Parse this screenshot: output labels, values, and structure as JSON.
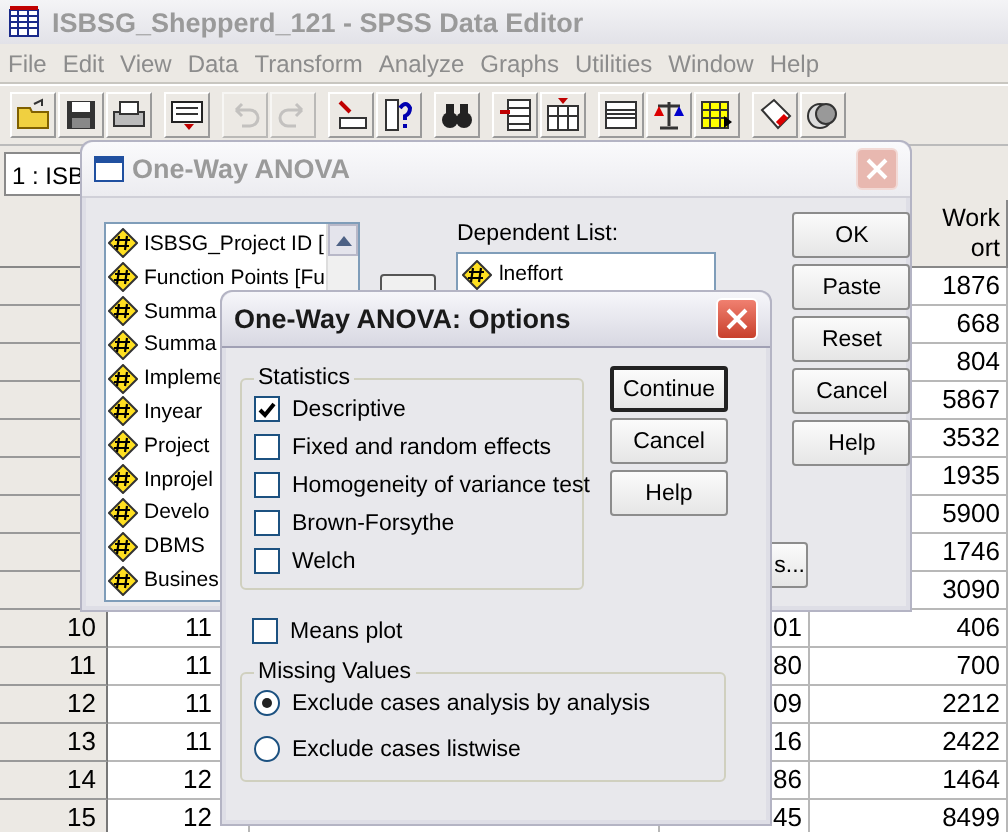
{
  "window": {
    "title": "ISBSG_Shepperd_121 - SPSS Data Editor"
  },
  "menu": [
    "File",
    "Edit",
    "View",
    "Data",
    "Transform",
    "Analyze",
    "Graphs",
    "Utilities",
    "Window",
    "Help"
  ],
  "toolbar": [
    {
      "items": [
        {
          "kind": "open",
          "disabled": false
        },
        {
          "kind": "save",
          "disabled": false
        },
        {
          "kind": "print",
          "disabled": false
        }
      ]
    },
    {
      "items": [
        {
          "kind": "recall",
          "disabled": false
        }
      ]
    },
    {
      "items": [
        {
          "kind": "undo",
          "disabled": true
        },
        {
          "kind": "redo",
          "disabled": true
        }
      ]
    },
    {
      "items": [
        {
          "kind": "goto",
          "disabled": false
        },
        {
          "kind": "variables",
          "disabled": false
        }
      ]
    },
    {
      "items": [
        {
          "kind": "find",
          "disabled": false
        }
      ]
    },
    {
      "items": [
        {
          "kind": "insert_case",
          "disabled": false
        },
        {
          "kind": "insert_variable",
          "disabled": false
        }
      ]
    },
    {
      "items": [
        {
          "kind": "split",
          "disabled": false
        },
        {
          "kind": "weight",
          "disabled": false
        },
        {
          "kind": "select",
          "disabled": false
        }
      ]
    },
    {
      "items": [
        {
          "kind": "labels",
          "disabled": false
        },
        {
          "kind": "sets",
          "disabled": false
        }
      ]
    }
  ],
  "cell_reference": "1 : ISB",
  "table": {
    "column_5_header": [
      "Work",
      "ort"
    ],
    "rows": [
      {
        "column_5": "1876"
      },
      {
        "column_5": "668"
      },
      {
        "column_5": "804"
      },
      {
        "column_5": "5867"
      },
      {
        "column_5": "3532"
      },
      {
        "column_5": "1935"
      },
      {
        "column_5": "5900"
      },
      {
        "column_5": "1746"
      },
      {
        "column_5": "3090"
      },
      {
        "row_number": "10",
        "column_2": "11",
        "column_4": "01",
        "column_5": "406"
      },
      {
        "row_number": "11",
        "column_2": "11",
        "column_4": "80",
        "column_5": "700"
      },
      {
        "row_number": "12",
        "column_2": "11",
        "column_4": "09",
        "column_5": "2212"
      },
      {
        "row_number": "13",
        "column_2": "11",
        "column_4": "16",
        "column_5": "2422"
      },
      {
        "row_number": "14",
        "column_2": "12",
        "column_4": "86",
        "column_5": "1464"
      },
      {
        "row_number": "15",
        "column_2": "12",
        "column_4": "45",
        "column_5": "8499"
      }
    ]
  },
  "anova_dialog": {
    "title": "One-Way ANOVA",
    "active": false,
    "variables": [
      "ISBSG_Project ID [",
      "Function Points [Fu",
      "Summa",
      "Summa",
      "Impleme",
      "Inyear",
      "Project",
      "Inprojel",
      "Develo",
      "DBMS",
      "Busines"
    ],
    "dependent_label": "Dependent List:",
    "dependent_items": [
      "lneffort"
    ],
    "buttons": [
      "OK",
      "Paste",
      "Reset",
      "Cancel",
      "Help"
    ],
    "partial_button": "s..."
  },
  "options_dialog": {
    "title": "One-Way ANOVA: Options",
    "active": true,
    "statistics_label": "Statistics",
    "statistics": [
      {
        "label": "Descriptive",
        "checked": true
      },
      {
        "label": "Fixed and random effects",
        "checked": false
      },
      {
        "label": "Homogeneity of variance test",
        "checked": false
      },
      {
        "label": "Brown-Forsythe",
        "checked": false
      },
      {
        "label": "Welch",
        "checked": false
      }
    ],
    "means_plot": {
      "label": "Means plot",
      "checked": false
    },
    "missing_label": "Missing Values",
    "missing": [
      {
        "label": "Exclude cases analysis by analysis",
        "selected": true
      },
      {
        "label": "Exclude cases listwise",
        "selected": false
      }
    ],
    "buttons": [
      {
        "label": "Continue",
        "default": true
      },
      {
        "label": "Cancel",
        "default": false
      },
      {
        "label": "Help",
        "default": false
      }
    ]
  }
}
